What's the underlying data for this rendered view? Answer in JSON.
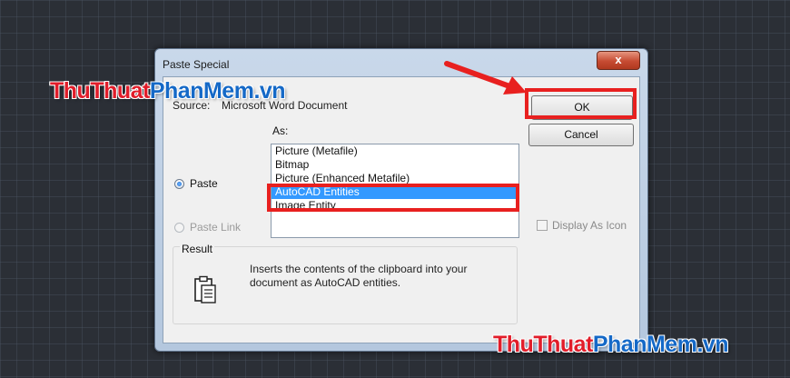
{
  "dialog": {
    "title": "Paste Special",
    "close_glyph": "x",
    "source_label": "Source:",
    "source_value": "Microsoft Word Document",
    "as_label": "As:",
    "paste_label": "Paste",
    "paste_link_label": "Paste Link",
    "list_items": [
      "Picture (Metafile)",
      "Bitmap",
      "Picture (Enhanced Metafile)",
      "AutoCAD Entities",
      "Image Entity"
    ],
    "selected_item": "AutoCAD Entities",
    "ok_label": "OK",
    "cancel_label": "Cancel",
    "display_as_icon_label": "Display As Icon",
    "result_legend": "Result",
    "result_text": "Inserts the contents of the clipboard into your document as AutoCAD entities."
  },
  "watermark": {
    "part1": "ThuThuat",
    "part2": "PhanMem",
    "part3": ".vn"
  },
  "colors": {
    "highlight": "#e8201f",
    "watermark_red": "#e11d2a",
    "watermark_blue": "#1569c7",
    "selection": "#3399ff"
  }
}
